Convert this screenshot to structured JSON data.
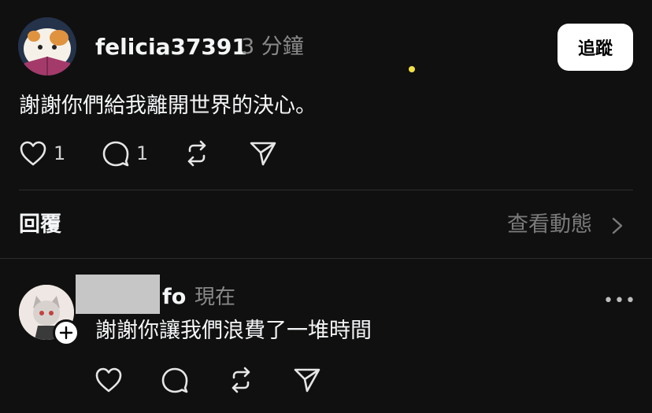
{
  "post": {
    "username": "felicia37391",
    "time": "3 分鐘",
    "follow_label": "追蹤",
    "text": "謝謝你們給我離開世界的決心。",
    "like_count": "1",
    "comment_count": "1",
    "icons": [
      "heart-icon",
      "comment-icon",
      "repost-icon",
      "share-icon"
    ]
  },
  "replies_header": {
    "label": "回覆",
    "view_activity_label": "查看動態"
  },
  "reply": {
    "username_visible": "fo",
    "time": "現在",
    "text": "謝謝你讓我們浪費了一堆時間",
    "more_label": "•••",
    "icons": [
      "heart-icon",
      "comment-icon",
      "repost-icon",
      "share-icon"
    ]
  },
  "colors": {
    "background": "#101010",
    "text": "#f3f5f7",
    "secondary": "#8a8a8a",
    "divider": "#2e2e2e",
    "follow_bg": "#ffffff"
  }
}
